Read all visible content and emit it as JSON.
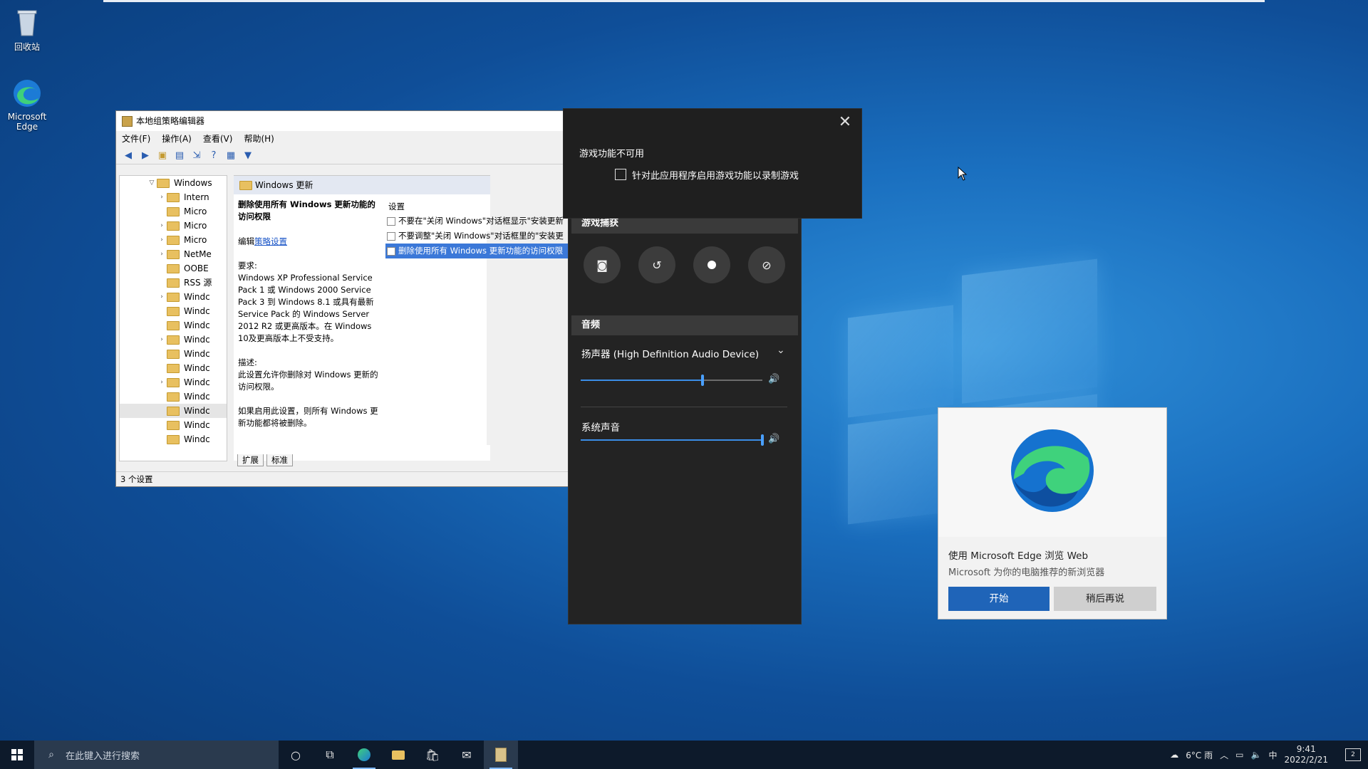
{
  "desktop": {
    "icons": [
      {
        "label": "回收站",
        "icon": "recycle-bin-icon"
      },
      {
        "label": "Microsoft Edge",
        "icon": "edge-icon"
      }
    ]
  },
  "gpedit": {
    "title": "本地组策略编辑器",
    "menu": [
      "文件(F)",
      "操作(A)",
      "查看(V)",
      "帮助(H)"
    ],
    "tree": [
      "Windows",
      "Intern",
      "Micro",
      "Micro",
      "Micro",
      "NetMe",
      "OOBE",
      "RSS 源",
      "Windc",
      "Windc",
      "Windc",
      "Windc",
      "Windc",
      "Windc",
      "Windc",
      "Windc",
      "Windc",
      "Windc",
      "Windc",
      "Windc"
    ],
    "panel_header": "Windows 更新",
    "policy_title": "删除使用所有 Windows 更新功能的访问权限",
    "edit_prefix": "编辑",
    "edit_link": "策略设置",
    "requirements_label": "要求:",
    "requirements": "Windows XP Professional Service Pack 1 或 Windows 2000 Service Pack 3 到 Windows 8.1 或具有最新 Service Pack 的 Windows Server 2012 R2 或更高版本。在 Windows 10及更高版本上不受支持。",
    "description_label": "描述:",
    "description": "此设置允许你删除对 Windows 更新的访问权限。",
    "description_more": "如果启用此设置，则所有 Windows 更新功能都将被删除。",
    "settings_header": "设置",
    "settings": [
      "不要在\"关闭 Windows\"对话框显示\"安装更新",
      "不要调整\"关闭 Windows\"对话框里的\"安装更",
      "删除使用所有 Windows 更新功能的访问权限"
    ],
    "tabs": [
      "扩展",
      "标准"
    ],
    "status": "3 个设置"
  },
  "gamebar": {
    "popup": {
      "title": "游戏功能不可用",
      "checkbox_label": "针对此应用程序启用游戏功能以录制游戏",
      "checked": false
    },
    "capture": {
      "title": "游戏捕获",
      "buttons": [
        "screenshot-icon",
        "replay-icon",
        "record-icon",
        "mic-off-icon"
      ]
    },
    "audio": {
      "title": "音频",
      "device": "扬声器 (High Definition Audio Device)",
      "device_volume": 0.67,
      "system_label": "系统声音",
      "system_volume": 1.0
    }
  },
  "edge_toast": {
    "title": "使用 Microsoft Edge 浏览 Web",
    "subtitle": "Microsoft 为你的电脑推荐的新浏览器",
    "primary": "开始",
    "secondary": "稍后再说"
  },
  "taskbar": {
    "search_placeholder": "在此键入进行搜索",
    "weather": "6°C 雨",
    "ime": "中",
    "time": "9:41",
    "date": "2022/2/21",
    "notifications": "2"
  }
}
